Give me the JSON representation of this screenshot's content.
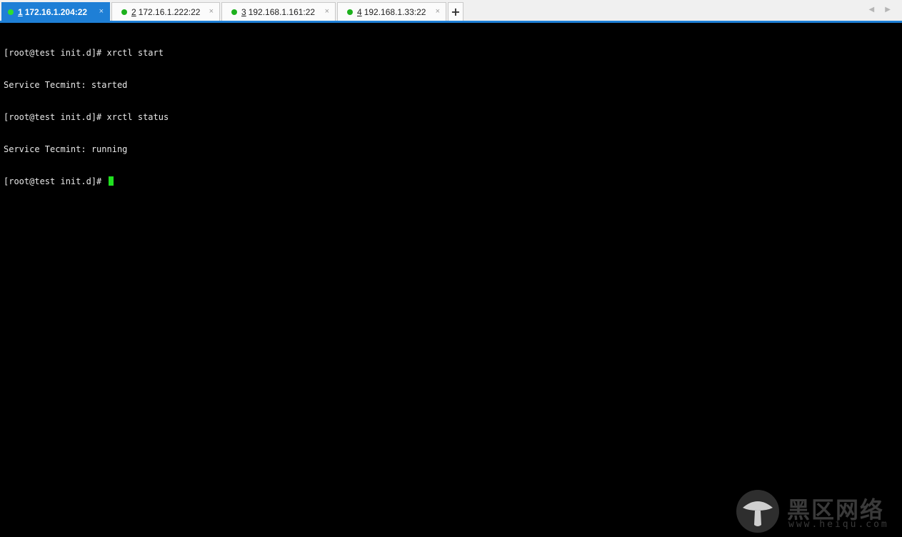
{
  "tabs": [
    {
      "number": "1",
      "host": "172.16.1.204:22",
      "active": true
    },
    {
      "number": "2",
      "host": "172.16.1.222:22",
      "active": false
    },
    {
      "number": "3",
      "host": "192.168.1.161:22",
      "active": false
    },
    {
      "number": "4",
      "host": "192.168.1.33:22",
      "active": false
    }
  ],
  "tab_close_glyph": "×",
  "add_tab_label": "+",
  "scroll_arrows": "◀ ▶",
  "terminal": {
    "lines": [
      "[root@test init.d]# xrctl start",
      "Service Tecmint: started",
      "[root@test init.d]# xrctl status",
      "Service Tecmint: running"
    ],
    "prompt": "[root@test init.d]# "
  },
  "watermark": {
    "text": "黑区网络",
    "url": "www.heiqu.com"
  },
  "colors": {
    "accent": "#1e7fd6",
    "status_dot": "#1db11d",
    "cursor": "#20e020",
    "terminal_bg": "#000000",
    "terminal_fg": "#e8e8e8"
  },
  "icons": {
    "status": "status-dot-icon",
    "close": "close-icon",
    "add": "plus-icon",
    "logo": "mushroom-logo-icon"
  }
}
